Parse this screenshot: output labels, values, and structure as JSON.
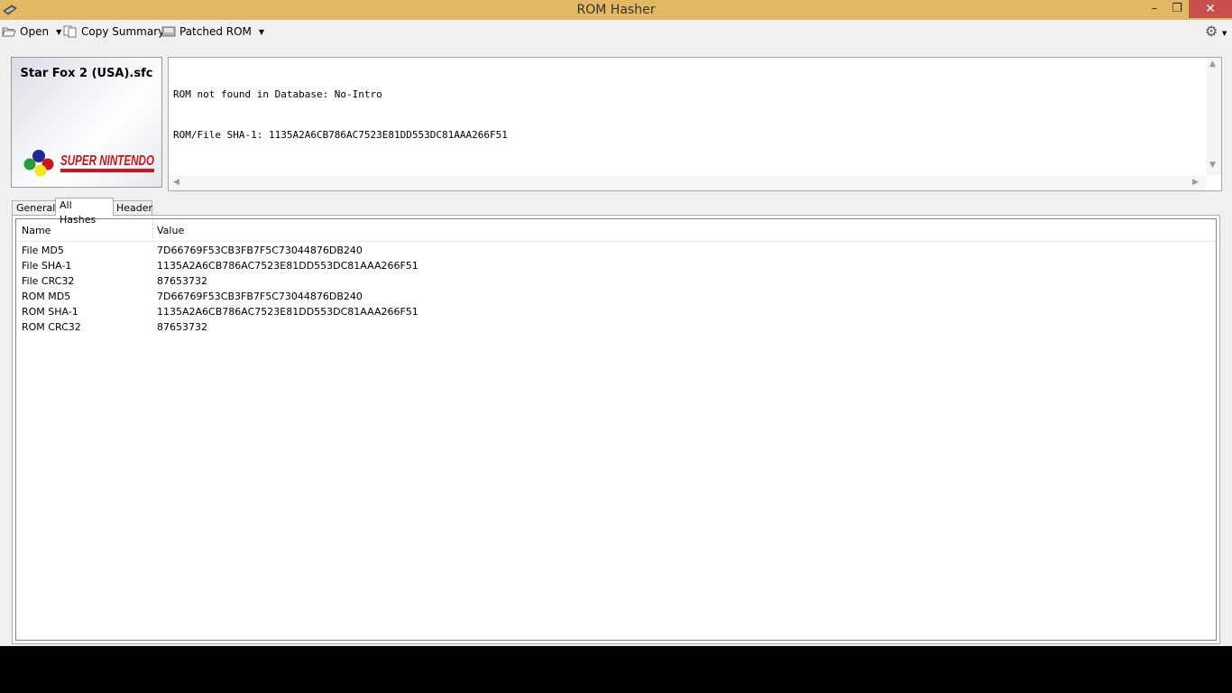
{
  "window": {
    "title": "ROM Hasher",
    "controls": {
      "minimize": "–",
      "maximize": "❐",
      "close": "✕"
    }
  },
  "toolbar": {
    "open_label": "Open",
    "copy_summary_label": "Copy Summary",
    "patched_rom_label": "Patched ROM",
    "dropdown_glyph": "▼",
    "settings_glyph": "⚙"
  },
  "rom": {
    "filename": "Star Fox 2 (USA).sfc"
  },
  "summary": {
    "lines": [
      "ROM not found in Database: No-Intro",
      "ROM/File SHA-1: 1135A2A6CB786AC7523E81DD553DC81AAA266F51"
    ]
  },
  "tabs": [
    {
      "label": "General",
      "active": false
    },
    {
      "label": "All Hashes",
      "active": true
    },
    {
      "label": "Header",
      "active": false
    }
  ],
  "hashes": {
    "columns": [
      "Name",
      "Value"
    ],
    "rows": [
      {
        "name": "File MD5",
        "value": "7D66769F53CB3FB7F5C73044876DB240"
      },
      {
        "name": "File SHA-1",
        "value": "1135A2A6CB786AC7523E81DD553DC81AAA266F51"
      },
      {
        "name": "File CRC32",
        "value": "87653732"
      },
      {
        "name": "ROM MD5",
        "value": "7D66769F53CB3FB7F5C73044876DB240"
      },
      {
        "name": "ROM SHA-1",
        "value": "1135A2A6CB786AC7523E81DD553DC81AAA266F51"
      },
      {
        "name": "ROM CRC32",
        "value": "87653732"
      }
    ]
  },
  "colors": {
    "titlebar": "#e2b865",
    "close_button": "#c7504a",
    "snes_red": "#d0121b"
  }
}
